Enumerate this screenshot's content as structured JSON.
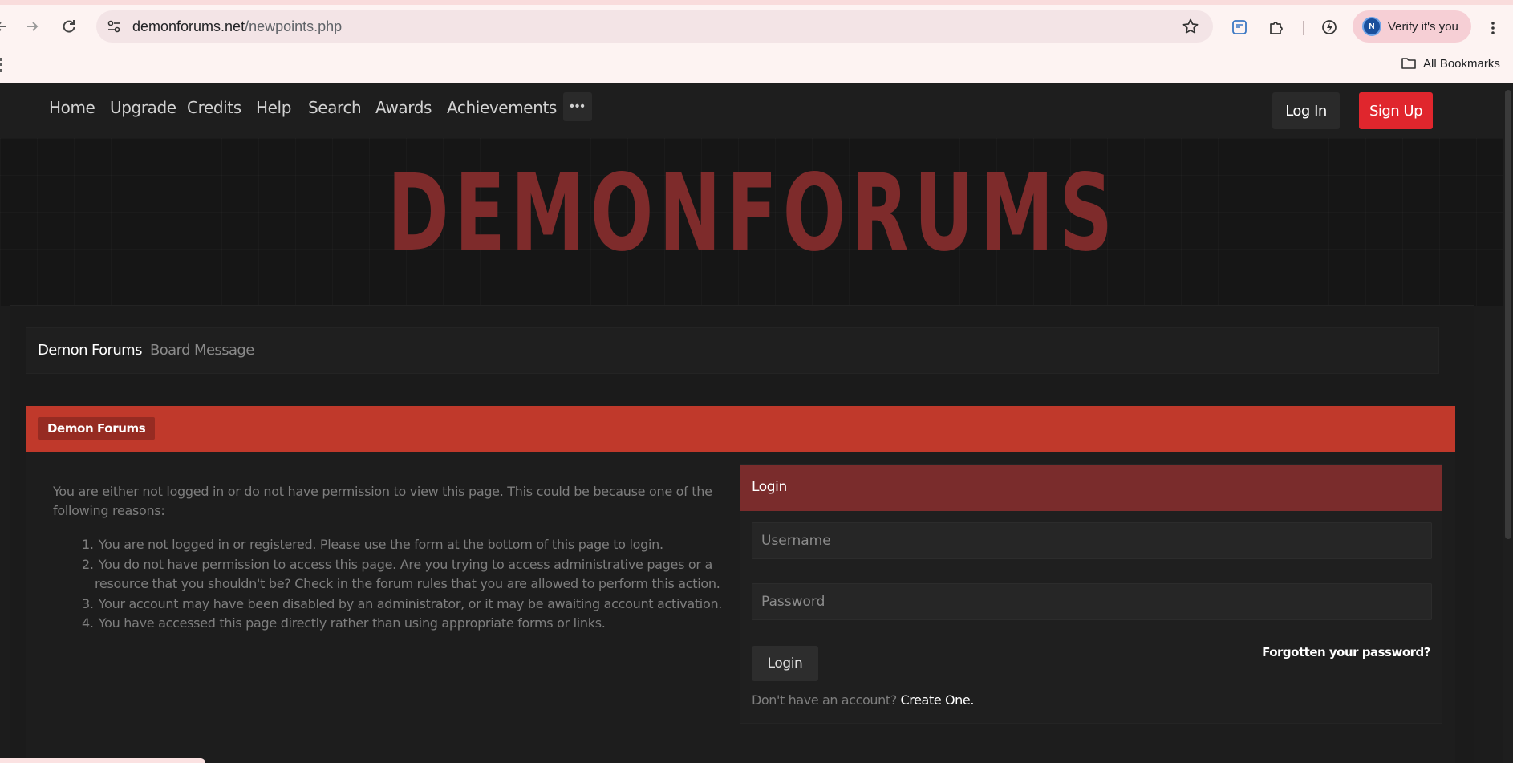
{
  "browser": {
    "url_domain": "demonforums.net",
    "url_path": "/newpoints.php",
    "profile_initial": "N",
    "profile_label": "Verify it's you",
    "bookmarks_label": "All Bookmarks"
  },
  "nav": {
    "items": [
      "Home",
      "Upgrade",
      "Credits",
      "Help",
      "Search",
      "Awards",
      "Achievements"
    ],
    "more_label": "•••",
    "login_label": "Log In",
    "signup_label": "Sign Up"
  },
  "banner": {
    "logo_text": "DEMONFORUMS"
  },
  "breadcrumb": {
    "root": "Demon Forums",
    "current": "Board Message"
  },
  "section": {
    "title": "Demon Forums"
  },
  "error": {
    "intro": "You are either not logged in or do not have permission to view this page. This could be because one of the following reasons:",
    "reasons": [
      "You are not logged in or registered. Please use the form at the bottom of this page to login.",
      "You do not have permission to access this page. Are you trying to access administrative pages or a resource that you shouldn't be? Check in the forum rules that you are allowed to perform this action.",
      "Your account may have been disabled by an administrator, or it may be awaiting account activation.",
      "You have accessed this page directly rather than using appropriate forms or links."
    ]
  },
  "login": {
    "title": "Login",
    "username_placeholder": "Username",
    "password_placeholder": "Password",
    "button_label": "Login",
    "forgot_label": "Forgotten your password?",
    "no_account_text": "Don't have an account?",
    "create_label": "Create One."
  },
  "colors": {
    "accent_red": "#c0392b",
    "login_header": "#7a2c2c",
    "signup_red": "#e0262d",
    "logo_red": "#7e2b2b"
  }
}
